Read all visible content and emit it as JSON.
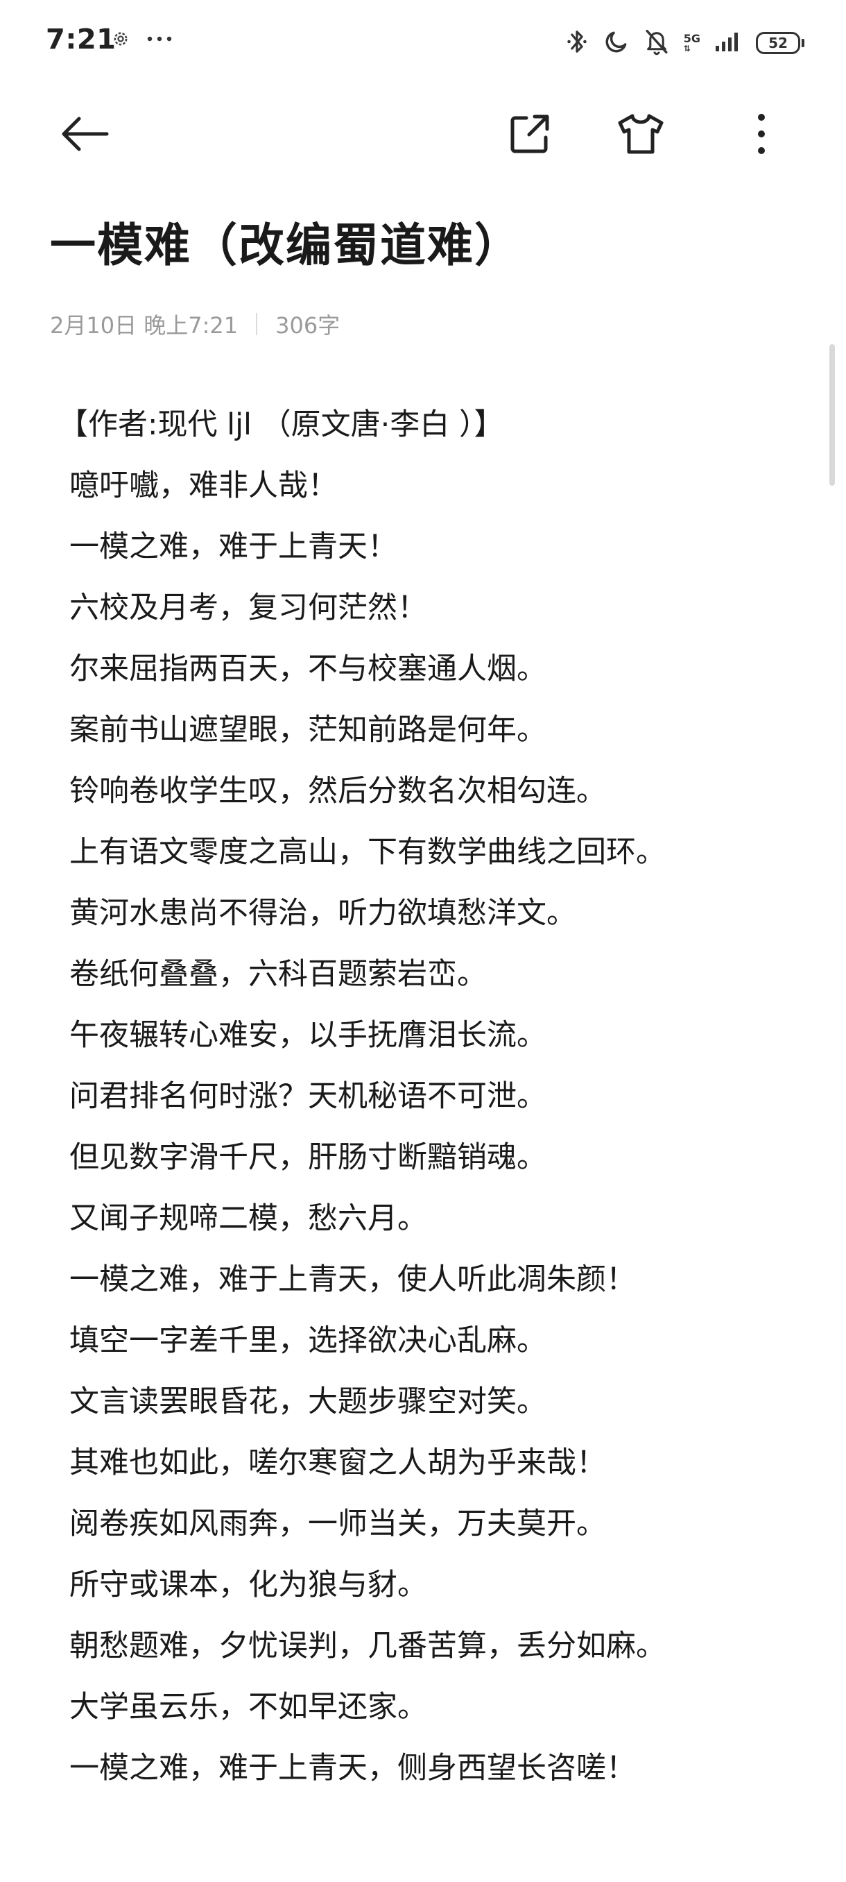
{
  "status_bar": {
    "time": "7:21",
    "network": "5G",
    "battery": "52",
    "left_icons": [
      "gear-icon",
      "more-dots-icon"
    ],
    "right_icons": [
      "bluetooth-icon",
      "moon-icon",
      "bell-off-icon",
      "signal-icon",
      "battery-icon"
    ]
  },
  "toolbar": {
    "back_icon": "arrow-left-icon",
    "share_icon": "share-export-icon",
    "theme_icon": "tshirt-icon",
    "more_icon": "more-vertical-icon"
  },
  "note": {
    "title": "一模难（改编蜀道难）",
    "date": "2月10日 晚上7:21",
    "word_count": "306字",
    "author_line": "【作者:现代 ljl （原文唐·李白 ）】",
    "lines": [
      "噫吁嚱，难非人哉！",
      "一模之难，难于上青天！",
      "六校及月考，复习何茫然！",
      "尔来屈指两百天，不与校塞通人烟。",
      "案前书山遮望眼，茫知前路是何年。",
      "铃响卷收学生叹，然后分数名次相勾连。",
      "上有语文零度之高山，下有数学曲线之回环。",
      "黄河水患尚不得治，听力欲填愁洋文。",
      "卷纸何叠叠，六科百题萦岩峦。",
      "午夜辗转心难安，以手抚膺泪长流。",
      "问君排名何时涨？天机秘语不可泄。",
      "但见数字滑千尺，肝肠寸断黯销魂。",
      "又闻子规啼二模，愁六月。",
      "一模之难，难于上青天，使人听此凋朱颜！",
      "填空一字差千里，选择欲决心乱麻。",
      "文言读罢眼昏花，大题步骤空对笑。",
      "其难也如此，嗟尔寒窗之人胡为乎来哉！",
      "阅卷疾如风雨奔，一师当关，万夫莫开。",
      "所守或课本，化为狼与豺。",
      "朝愁题难，夕忧误判，几番苦算，丢分如麻。",
      "大学虽云乐，不如早还家。",
      "一模之难，难于上青天，侧身西望长咨嗟！"
    ]
  },
  "colors": {
    "text": "#1a1a1a",
    "meta": "#9a9a9a",
    "background": "#ffffff"
  }
}
